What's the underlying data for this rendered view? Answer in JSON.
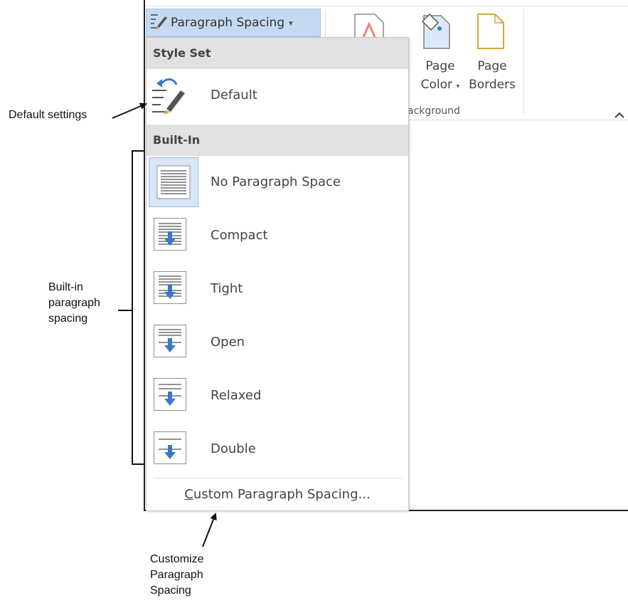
{
  "ribbon": {
    "paragraph_spacing_button": "Paragraph Spacing",
    "page_color": {
      "line1": "Page",
      "line2": "Color"
    },
    "page_borders": {
      "line1": "Page",
      "line2": "Borders"
    },
    "group_label": "ackground"
  },
  "menu": {
    "style_set_header": "Style Set",
    "default_label": "Default",
    "builtin_header": "Built-In",
    "items": [
      {
        "label": "No Paragraph Space"
      },
      {
        "label": "Compact"
      },
      {
        "label": "Tight"
      },
      {
        "label": "Open"
      },
      {
        "label": "Relaxed"
      },
      {
        "label": "Double"
      }
    ],
    "custom_first_letter": "C",
    "custom_rest": "ustom Paragraph Spacing..."
  },
  "annotations": {
    "default_settings": "Default settings",
    "builtin_line1": "Built-in",
    "builtin_line2": "paragraph",
    "builtin_line3": "spacing",
    "customize_line1": "Customize",
    "customize_line2": "Paragraph",
    "customize_line3": "Spacing"
  },
  "colors": {
    "accent": "#3b78c4",
    "menu_header_bg": "#e1e1e1",
    "button_bg": "#c5daf2"
  }
}
